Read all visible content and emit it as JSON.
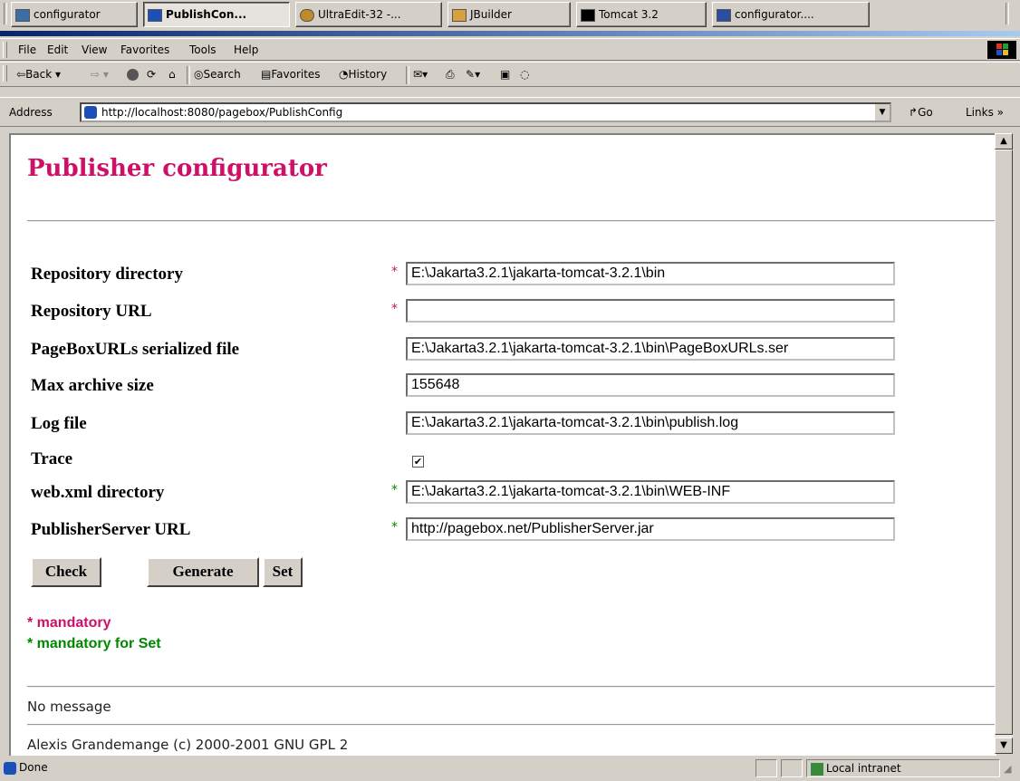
{
  "taskbar": {
    "items": [
      {
        "label": "configurator",
        "active": false
      },
      {
        "label": "PublishCon...",
        "active": true
      },
      {
        "label": "UltraEdit-32 -...",
        "active": false
      },
      {
        "label": "JBuilder",
        "active": false
      },
      {
        "label": "Tomcat 3.2",
        "active": false
      },
      {
        "label": "configurator....",
        "active": false
      }
    ]
  },
  "menu": {
    "items": [
      "File",
      "Edit",
      "View",
      "Favorites",
      "Tools",
      "Help"
    ]
  },
  "toolbar": {
    "back": "Back",
    "search": "Search",
    "favorites": "Favorites",
    "history": "History"
  },
  "address": {
    "label": "Address",
    "url": "http://localhost:8080/pagebox/PublishConfig",
    "go": "Go",
    "links": "Links »"
  },
  "page": {
    "title": "Publisher configurator",
    "fields": [
      {
        "label": "Repository directory",
        "value": "E:\\Jakarta3.2.1\\jakarta-tomcat-3.2.1\\bin",
        "marker": "*",
        "marker_color": "#cc1166"
      },
      {
        "label": "Repository URL",
        "value": "",
        "marker": "*",
        "marker_color": "#cc1166"
      },
      {
        "label": "PageBoxURLs serialized file",
        "value": "E:\\Jakarta3.2.1\\jakarta-tomcat-3.2.1\\bin\\PageBoxURLs.ser",
        "marker": "",
        "marker_color": ""
      },
      {
        "label": "Max archive size",
        "value": "155648",
        "marker": "",
        "marker_color": ""
      },
      {
        "label": "Log file",
        "value": "E:\\Jakarta3.2.1\\jakarta-tomcat-3.2.1\\bin\\publish.log",
        "marker": "",
        "marker_color": ""
      },
      {
        "label": "Trace",
        "checked": true
      },
      {
        "label": "web.xml directory",
        "value": "E:\\Jakarta3.2.1\\jakarta-tomcat-3.2.1\\bin\\WEB-INF",
        "marker": "*",
        "marker_color": "#008800"
      },
      {
        "label": "PublisherServer URL",
        "value": "http://pagebox.net/PublisherServer.jar",
        "marker": "*",
        "marker_color": "#008800"
      }
    ],
    "buttons": {
      "check": "Check",
      "generate": "Generate",
      "set": "Set"
    },
    "legend": {
      "mandatory": "* mandatory",
      "mandatory_color": "#cc1166",
      "mandatory_set": "* mandatory for Set",
      "mandatory_set_color": "#008800"
    },
    "message": "No message",
    "footer": "Alexis Grandemange (c) 2000-2001 GNU GPL 2"
  },
  "status": {
    "left": "Done",
    "zone": "Local intranet"
  }
}
